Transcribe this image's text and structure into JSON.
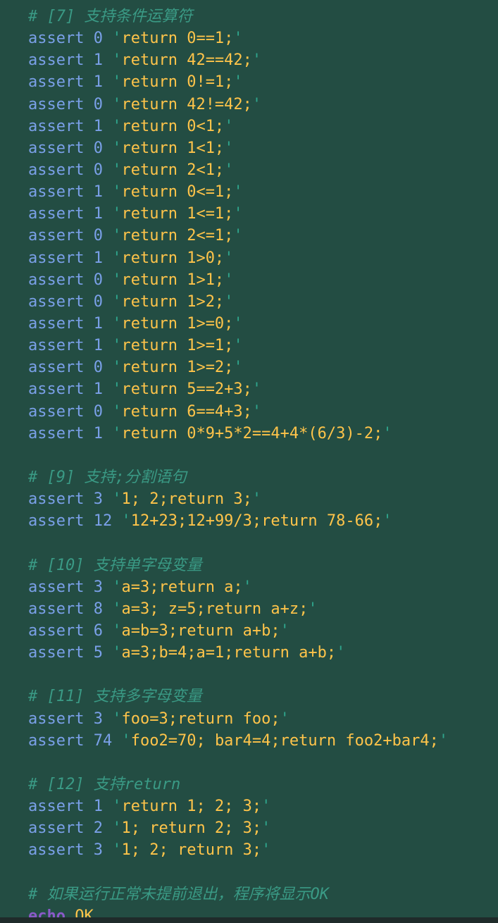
{
  "editor": {
    "lines": [
      {
        "type": "comment",
        "text": "# [7] 支持条件运算符"
      },
      {
        "type": "assert",
        "kw": "assert",
        "num": "0",
        "code": "return 0==1;"
      },
      {
        "type": "assert",
        "kw": "assert",
        "num": "1",
        "code": "return 42==42;"
      },
      {
        "type": "assert",
        "kw": "assert",
        "num": "1",
        "code": "return 0!=1;"
      },
      {
        "type": "assert",
        "kw": "assert",
        "num": "0",
        "code": "return 42!=42;"
      },
      {
        "type": "assert",
        "kw": "assert",
        "num": "1",
        "code": "return 0<1;"
      },
      {
        "type": "assert",
        "kw": "assert",
        "num": "0",
        "code": "return 1<1;"
      },
      {
        "type": "assert",
        "kw": "assert",
        "num": "0",
        "code": "return 2<1;"
      },
      {
        "type": "assert",
        "kw": "assert",
        "num": "1",
        "code": "return 0<=1;"
      },
      {
        "type": "assert",
        "kw": "assert",
        "num": "1",
        "code": "return 1<=1;"
      },
      {
        "type": "assert",
        "kw": "assert",
        "num": "0",
        "code": "return 2<=1;"
      },
      {
        "type": "assert",
        "kw": "assert",
        "num": "1",
        "code": "return 1>0;"
      },
      {
        "type": "assert",
        "kw": "assert",
        "num": "0",
        "code": "return 1>1;"
      },
      {
        "type": "assert",
        "kw": "assert",
        "num": "0",
        "code": "return 1>2;"
      },
      {
        "type": "assert",
        "kw": "assert",
        "num": "1",
        "code": "return 1>=0;"
      },
      {
        "type": "assert",
        "kw": "assert",
        "num": "1",
        "code": "return 1>=1;"
      },
      {
        "type": "assert",
        "kw": "assert",
        "num": "0",
        "code": "return 1>=2;"
      },
      {
        "type": "assert",
        "kw": "assert",
        "num": "1",
        "code": "return 5==2+3;"
      },
      {
        "type": "assert",
        "kw": "assert",
        "num": "0",
        "code": "return 6==4+3;"
      },
      {
        "type": "assert",
        "kw": "assert",
        "num": "1",
        "code": "return 0*9+5*2==4+4*(6/3)-2;"
      },
      {
        "type": "blank"
      },
      {
        "type": "comment",
        "text": "# [9] 支持;分割语句"
      },
      {
        "type": "assert",
        "kw": "assert",
        "num": "3",
        "code": "1; 2;return 3;"
      },
      {
        "type": "assert",
        "kw": "assert",
        "num": "12",
        "code": "12+23;12+99/3;return 78-66;"
      },
      {
        "type": "blank"
      },
      {
        "type": "comment",
        "text": "# [10] 支持单字母变量"
      },
      {
        "type": "assert",
        "kw": "assert",
        "num": "3",
        "code": "a=3;return a;"
      },
      {
        "type": "assert",
        "kw": "assert",
        "num": "8",
        "code": "a=3; z=5;return a+z;"
      },
      {
        "type": "assert",
        "kw": "assert",
        "num": "6",
        "code": "a=b=3;return a+b;"
      },
      {
        "type": "assert",
        "kw": "assert",
        "num": "5",
        "code": "a=3;b=4;a=1;return a+b;"
      },
      {
        "type": "blank"
      },
      {
        "type": "comment",
        "text": "# [11] 支持多字母变量"
      },
      {
        "type": "assert",
        "kw": "assert",
        "num": "3",
        "code": "foo=3;return foo;"
      },
      {
        "type": "assert",
        "kw": "assert",
        "num": "74",
        "code": "foo2=70; bar4=4;return foo2+bar4;"
      },
      {
        "type": "blank"
      },
      {
        "type": "comment",
        "text": "# [12] 支持return"
      },
      {
        "type": "assert",
        "kw": "assert",
        "num": "1",
        "code": "return 1; 2; 3;"
      },
      {
        "type": "assert",
        "kw": "assert",
        "num": "2",
        "code": "1; return 2; 3;"
      },
      {
        "type": "assert",
        "kw": "assert",
        "num": "3",
        "code": "1; 2; return 3;"
      },
      {
        "type": "blank"
      },
      {
        "type": "comment",
        "text": "# 如果运行正常未提前退出，程序将显示OK"
      },
      {
        "type": "echo",
        "cmd": "echo",
        "arg": "OK"
      }
    ]
  },
  "colors": {
    "background": "#234d43",
    "comment": "#3a9a85",
    "keyword": "#7aa0e8",
    "string": "#ffc44a",
    "quote": "#2fa58c",
    "command": "#8a5ac8"
  }
}
